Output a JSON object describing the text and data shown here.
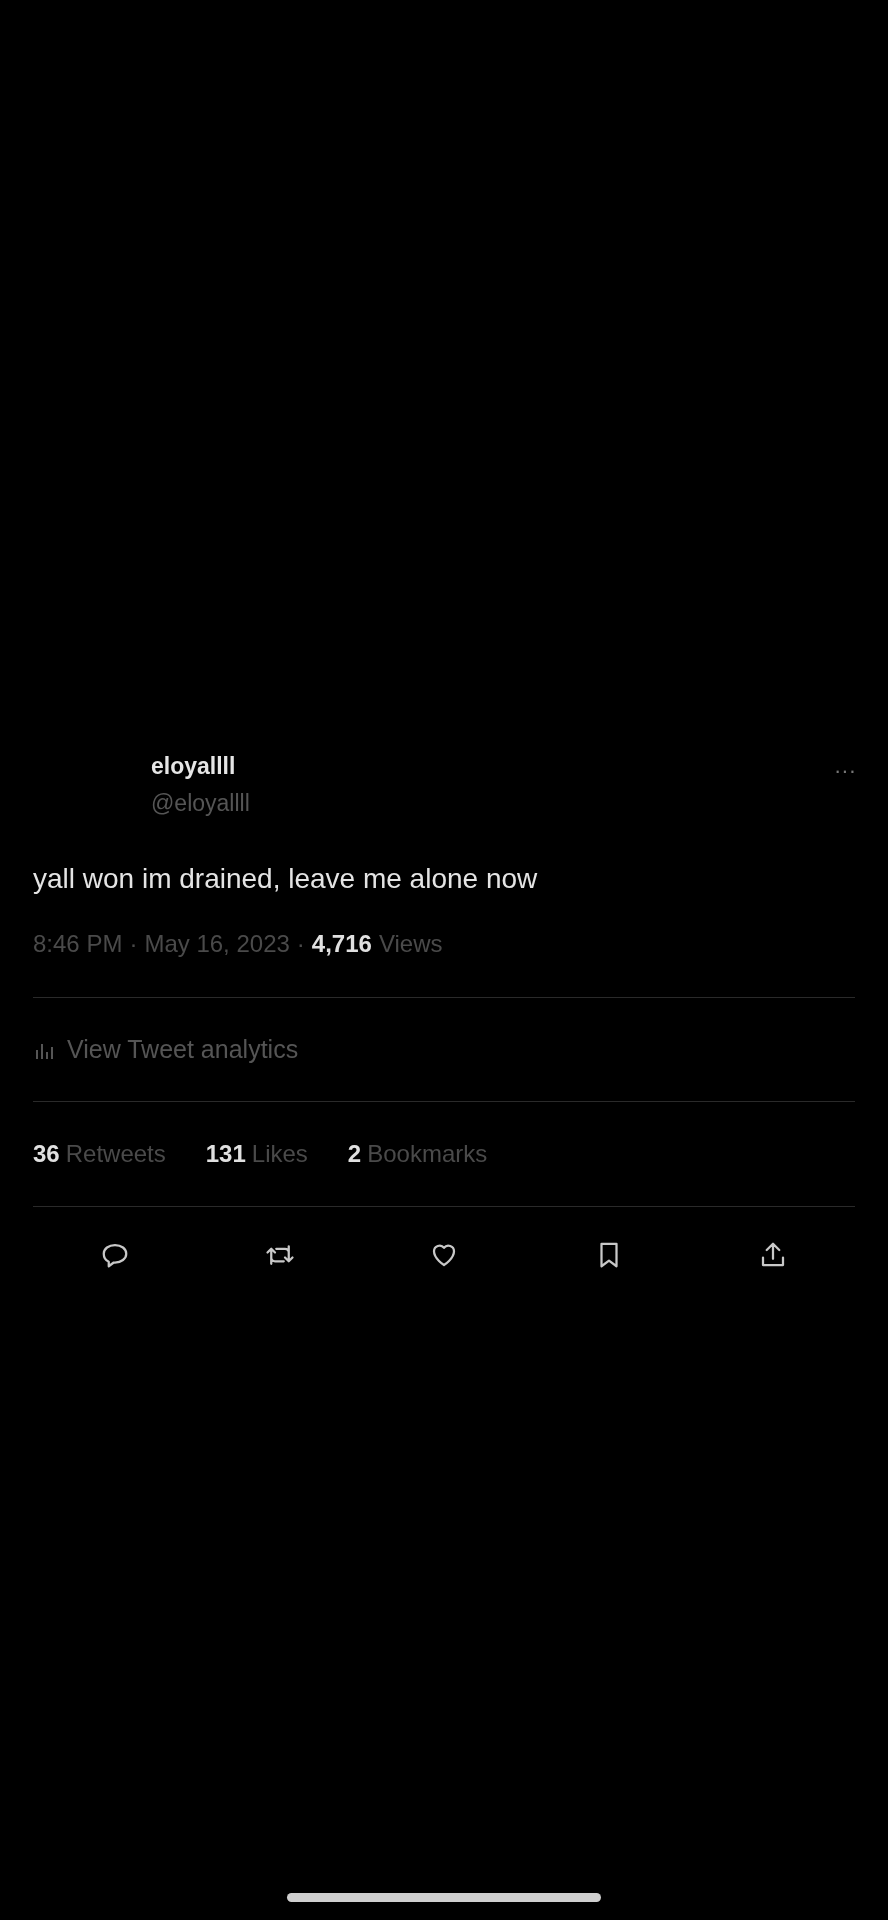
{
  "tweet": {
    "display_name": "eloyallll",
    "handle": "@eloyallll",
    "more": "···",
    "text": "yall won im drained, leave me alone now",
    "time": "8:46 PM",
    "separator": "·",
    "date": "May 16, 2023",
    "views_count": "4,716",
    "views_label": "Views",
    "analytics": "View Tweet analytics",
    "stats": [
      {
        "count": "36",
        "label": "Retweets"
      },
      {
        "count": "131",
        "label": "Likes"
      },
      {
        "count": "2",
        "label": "Bookmarks"
      }
    ],
    "actions": [
      {
        "kind": "reply"
      },
      {
        "kind": "retweet"
      },
      {
        "kind": "like"
      },
      {
        "kind": "bookmark"
      },
      {
        "kind": "share"
      }
    ]
  }
}
